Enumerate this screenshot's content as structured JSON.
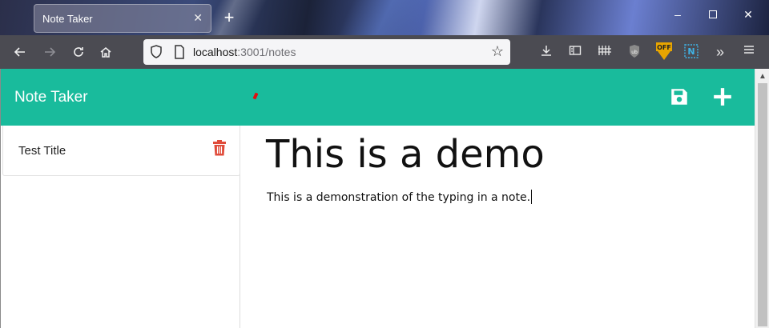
{
  "browser": {
    "tab": {
      "title": "Note Taker",
      "close": "✕"
    },
    "new_tab": "+",
    "window": {
      "minimize": "–",
      "close": "✕"
    },
    "url": {
      "host": "localhost",
      "rest": ":3001/notes"
    },
    "toolbar_icons": [
      "download-icon",
      "reader-view-icon",
      "library-icon",
      "ublock-icon",
      "extension-off-icon",
      "extension-n-icon",
      "overflow-icon",
      "menu-icon"
    ],
    "extension_off_label": "OFF",
    "extension_n_label": "N",
    "overflow": "»"
  },
  "app": {
    "title": "Note Taker",
    "accent_color": "#19bb9c",
    "delete_color": "#e04b3a"
  },
  "sidebar": {
    "notes": [
      {
        "title": "Test Title"
      }
    ]
  },
  "editor": {
    "title": "This is a demo",
    "body": "This is a demonstration of the typing in a note."
  }
}
